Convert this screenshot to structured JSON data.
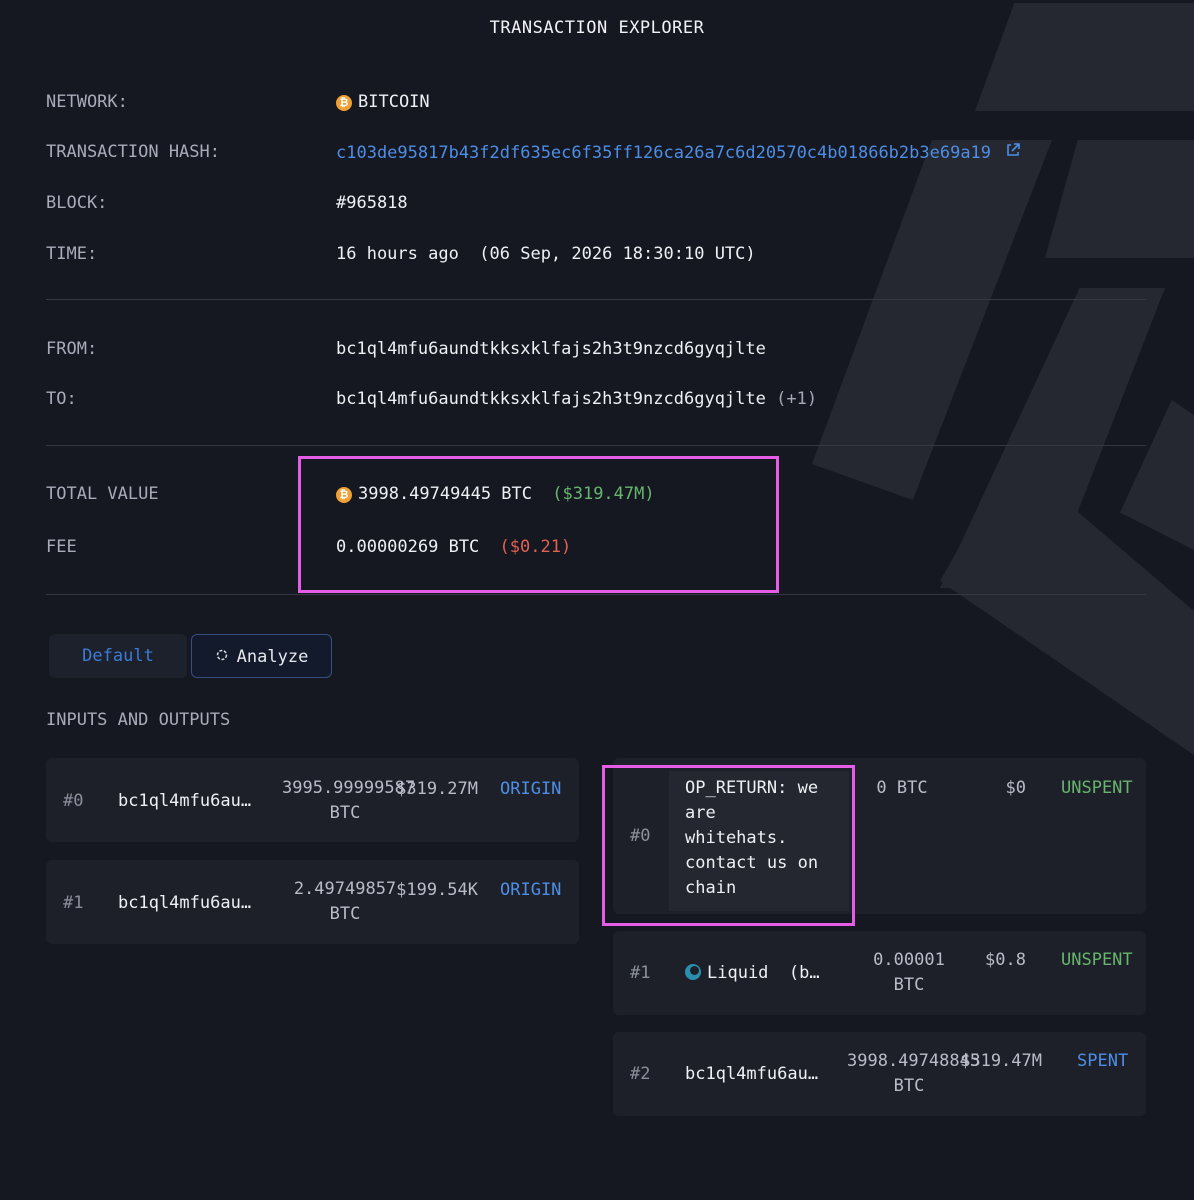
{
  "title": "TRANSACTION EXPLORER",
  "details": {
    "network_label": "NETWORK:",
    "network_value": "BITCOIN",
    "hash_label": "TRANSACTION HASH:",
    "hash_value": "c103de95817b43f2df635ec6f35ff126ca26a7c6d20570c4b01866b2b3e69a19",
    "block_label": "BLOCK:",
    "block_value": "#965818",
    "time_label": "TIME:",
    "time_value": "16 hours ago  (06 Sep, 2026 18:30:10 UTC)"
  },
  "parties": {
    "from_label": "FROM:",
    "from_value": "bc1ql4mfu6aundtkksxklfajs2h3t9nzcd6gyqjlte",
    "to_label": "TO:",
    "to_value": "bc1ql4mfu6aundtkksxklfajs2h3t9nzcd6gyqjlte",
    "to_extra": "(+1)"
  },
  "value": {
    "total_label": "TOTAL VALUE",
    "total_btc": "3998.49749445 BTC",
    "total_usd": "($319.47M)",
    "fee_label": "FEE",
    "fee_btc": "0.00000269 BTC",
    "fee_usd": "($0.21)"
  },
  "tabs": {
    "default_label": "Default",
    "analyze_label": "Analyze"
  },
  "io": {
    "section_label": "INPUTS AND OUTPUTS",
    "inputs": [
      {
        "index": "#0",
        "address": "bc1ql4mfu6au…",
        "amount": "3995.99999587",
        "unit": "BTC",
        "usd": "$319.27M",
        "status": "ORIGIN"
      },
      {
        "index": "#1",
        "address": "bc1ql4mfu6au…",
        "amount": "2.49749857",
        "unit": "BTC",
        "usd": "$199.54K",
        "status": "ORIGIN"
      }
    ],
    "outputs": [
      {
        "index": "#0",
        "address": "OP_RETURN: we are whitehats. contact us on chain",
        "address_lines": [
          "OP_RETURN: we",
          "are",
          "whitehats.",
          "contact us on",
          "chain"
        ],
        "amount": "0 BTC",
        "usd": "$0",
        "status": "UNSPENT"
      },
      {
        "index": "#1",
        "address": "Liquid  (b…",
        "amount": "0.00001",
        "unit": "BTC",
        "usd": "$0.8",
        "status": "UNSPENT"
      },
      {
        "index": "#2",
        "address": "bc1ql4mfu6au…",
        "amount": "3998.49748845",
        "unit": "BTC",
        "usd": "$319.47M",
        "status": "SPENT"
      }
    ]
  },
  "colors": {
    "background": "#151821",
    "accent_blue": "#4d8ee6",
    "green": "#67b56c",
    "red": "#e0614f",
    "highlight": "#e55de6",
    "bitcoin": "#f0a034"
  }
}
